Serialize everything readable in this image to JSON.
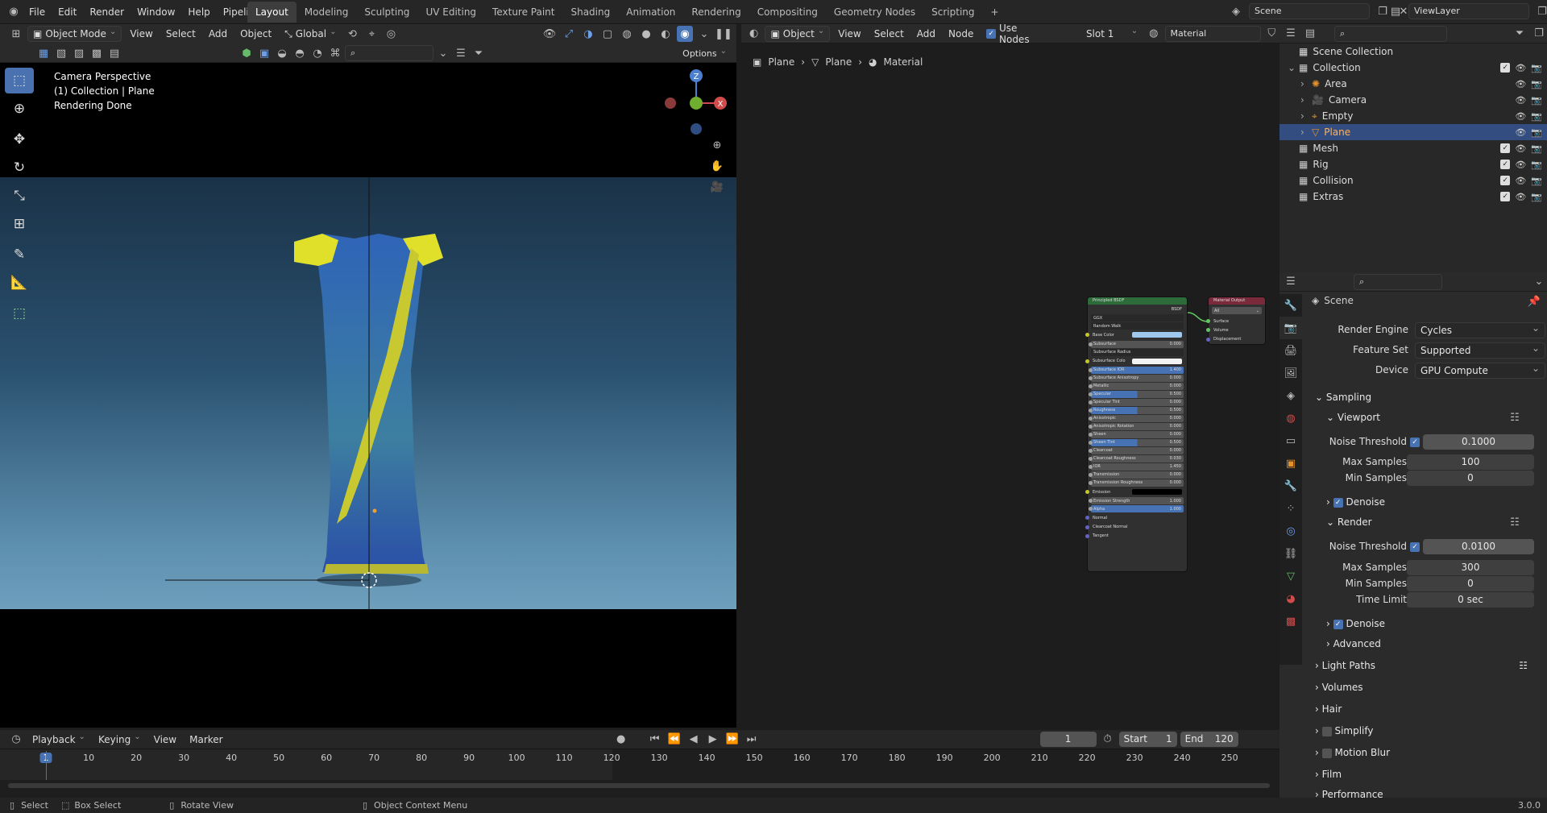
{
  "topbar": {
    "menus": [
      "File",
      "Edit",
      "Render",
      "Window",
      "Help",
      "Pipeline"
    ],
    "workspaces": [
      "Layout",
      "Modeling",
      "Sculpting",
      "UV Editing",
      "Texture Paint",
      "Shading",
      "Animation",
      "Rendering",
      "Compositing",
      "Geometry Nodes",
      "Scripting"
    ],
    "active_workspace": "Layout",
    "scene": "Scene",
    "view_layer": "ViewLayer"
  },
  "viewport": {
    "mode": "Object Mode",
    "menus": [
      "View",
      "Select",
      "Add",
      "Object"
    ],
    "orientation": "Global",
    "options_label": "Options",
    "overlay_line1": "Camera Perspective",
    "overlay_line2": "(1) Collection | Plane",
    "overlay_line3": "Rendering Done",
    "gizmo_z": "Z",
    "gizmo_x": "X"
  },
  "node_editor": {
    "object_mode": "Object",
    "menus": [
      "View",
      "Select",
      "Add",
      "Node"
    ],
    "use_nodes_label": "Use Nodes",
    "slot": "Slot 1",
    "material": "Material",
    "breadcrumb": [
      "Plane",
      "Plane",
      "Material"
    ],
    "bsdf_title": "Principled BSDF",
    "bsdf_out": "BSDF",
    "bsdf_rows": [
      {
        "label": "GGX",
        "value": "",
        "kind": "drop"
      },
      {
        "label": "Random Walk",
        "value": "",
        "kind": "drop"
      },
      {
        "label": "Base Color",
        "value": "",
        "kind": "color-blue"
      },
      {
        "label": "Subsurface",
        "value": "0.000",
        "kind": "bar"
      },
      {
        "label": "Subsurface Radius",
        "value": "",
        "kind": "drop"
      },
      {
        "label": "Subsurface Colo",
        "value": "",
        "kind": "color-white"
      },
      {
        "label": "Subsurface IOR",
        "value": "1.400",
        "kind": "bar-fill"
      },
      {
        "label": "Subsurface Anisotropy",
        "value": "0.000",
        "kind": "bar"
      },
      {
        "label": "Metallic",
        "value": "0.000",
        "kind": "bar"
      },
      {
        "label": "Specular",
        "value": "0.500",
        "kind": "bar-half"
      },
      {
        "label": "Specular Tint",
        "value": "0.000",
        "kind": "bar"
      },
      {
        "label": "Roughness",
        "value": "0.500",
        "kind": "bar-half"
      },
      {
        "label": "Anisotropic",
        "value": "0.000",
        "kind": "bar"
      },
      {
        "label": "Anisotropic Rotation",
        "value": "0.000",
        "kind": "bar"
      },
      {
        "label": "Sheen",
        "value": "0.000",
        "kind": "bar"
      },
      {
        "label": "Sheen Tint",
        "value": "0.500",
        "kind": "bar-half"
      },
      {
        "label": "Clearcoat",
        "value": "0.000",
        "kind": "bar"
      },
      {
        "label": "Clearcoat Roughness",
        "value": "0.030",
        "kind": "bar"
      },
      {
        "label": "IOR",
        "value": "1.450",
        "kind": "bar"
      },
      {
        "label": "Transmission",
        "value": "0.000",
        "kind": "bar"
      },
      {
        "label": "Transmission Roughness",
        "value": "0.000",
        "kind": "bar"
      },
      {
        "label": "Emission",
        "value": "",
        "kind": "color-black"
      },
      {
        "label": "Emission Strength",
        "value": "1.000",
        "kind": "bar"
      },
      {
        "label": "Alpha",
        "value": "1.000",
        "kind": "bar-fill"
      },
      {
        "label": "Normal",
        "value": "",
        "kind": "text"
      },
      {
        "label": "Clearcoat Normal",
        "value": "",
        "kind": "text"
      },
      {
        "label": "Tangent",
        "value": "",
        "kind": "text"
      }
    ],
    "output_title": "Material Output",
    "output_target": "All",
    "output_rows": [
      "Surface",
      "Volume",
      "Displacement"
    ]
  },
  "outliner": {
    "root": "Scene Collection",
    "items": [
      {
        "label": "Collection",
        "indent": 1,
        "expanded": true,
        "selected": false
      },
      {
        "label": "Area",
        "indent": 2,
        "expanded": false,
        "selected": false
      },
      {
        "label": "Camera",
        "indent": 2,
        "expanded": false,
        "selected": false
      },
      {
        "label": "Empty",
        "indent": 2,
        "expanded": false,
        "selected": false
      },
      {
        "label": "Plane",
        "indent": 2,
        "expanded": false,
        "selected": true
      },
      {
        "label": "Mesh",
        "indent": 1,
        "expanded": false,
        "selected": false
      },
      {
        "label": "Rig",
        "indent": 1,
        "expanded": false,
        "selected": false
      },
      {
        "label": "Collision",
        "indent": 1,
        "expanded": false,
        "selected": false
      },
      {
        "label": "Extras",
        "indent": 1,
        "expanded": false,
        "selected": false
      }
    ]
  },
  "properties": {
    "context": "Scene",
    "render_engine_label": "Render Engine",
    "render_engine": "Cycles",
    "feature_set_label": "Feature Set",
    "feature_set": "Supported",
    "device_label": "Device",
    "device": "GPU Compute",
    "sampling": "Sampling",
    "viewport": "Viewport",
    "render": "Render",
    "noise_threshold_label": "Noise Threshold",
    "max_samples_label": "Max Samples",
    "min_samples_label": "Min Samples",
    "time_limit_label": "Time Limit",
    "vp_noise_threshold": "0.1000",
    "vp_max_samples": "100",
    "vp_min_samples": "0",
    "r_noise_threshold": "0.0100",
    "r_max_samples": "300",
    "r_min_samples": "0",
    "r_time_limit": "0 sec",
    "denoise": "Denoise",
    "advanced": "Advanced",
    "panels": [
      "Light Paths",
      "Volumes",
      "Hair",
      "Simplify",
      "Motion Blur",
      "Film",
      "Performance"
    ]
  },
  "timeline": {
    "menus": [
      "Playback",
      "Keying",
      "View",
      "Marker"
    ],
    "current_frame": "1",
    "start_label": "Start",
    "start": "1",
    "end_label": "End",
    "end": "120",
    "ticks": [
      "1",
      "10",
      "20",
      "30",
      "40",
      "50",
      "60",
      "70",
      "80",
      "90",
      "100",
      "110",
      "120",
      "130",
      "140",
      "150",
      "160",
      "170",
      "180",
      "190",
      "200",
      "210",
      "220",
      "230",
      "240",
      "250"
    ]
  },
  "status": {
    "select": "Select",
    "box_select": "Box Select",
    "rotate_view": "Rotate View",
    "context_menu": "Object Context Menu",
    "version": "3.0.0"
  },
  "colors": {
    "accent": "#4772b3",
    "selection": "#334d80",
    "node_header_bsdf": "#2d6b3a",
    "node_header_output": "#7a2a3a"
  }
}
